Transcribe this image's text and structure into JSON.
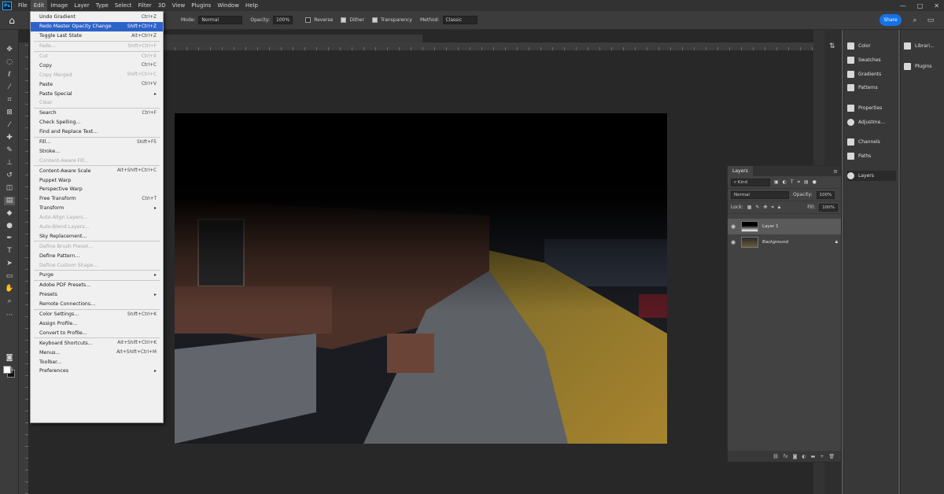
{
  "menubar": {
    "app_icon": "Ps",
    "items": [
      "File",
      "Edit",
      "Image",
      "Layer",
      "Type",
      "Select",
      "Filter",
      "3D",
      "View",
      "Plugins",
      "Window",
      "Help"
    ],
    "window_controls": [
      "—",
      "□",
      "✕"
    ]
  },
  "options_bar": {
    "mode_label": "Mode:",
    "mode_value": "Normal",
    "opacity_label": "Opacity:",
    "opacity_value": "100%",
    "reverse_label": "Reverse",
    "dither_label": "Dither",
    "transparency_label": "Transparency",
    "method_label": "Method:",
    "method_value": "Classic",
    "share_label": "Share"
  },
  "edit_menu": {
    "groups": [
      [
        {
          "label": "Undo Gradient",
          "shortcut": "Ctrl+Z"
        },
        {
          "label": "Redo Master Opacity Change",
          "shortcut": "Shift+Ctrl+Z",
          "highlight": true
        },
        {
          "label": "Toggle Last State",
          "shortcut": "Alt+Ctrl+Z"
        }
      ],
      [
        {
          "label": "Fade...",
          "shortcut": "Shift+Ctrl+F",
          "disabled": true
        }
      ],
      [
        {
          "label": "Cut",
          "shortcut": "Ctrl+X",
          "disabled": true
        },
        {
          "label": "Copy",
          "shortcut": "Ctrl+C"
        },
        {
          "label": "Copy Merged",
          "shortcut": "Shift+Ctrl+C",
          "disabled": true
        },
        {
          "label": "Paste",
          "shortcut": "Ctrl+V"
        },
        {
          "label": "Paste Special",
          "shortcut": "",
          "submenu": true
        },
        {
          "label": "Clear",
          "shortcut": "",
          "disabled": true
        }
      ],
      [
        {
          "label": "Search",
          "shortcut": "Ctrl+F"
        },
        {
          "label": "Check Spelling...",
          "shortcut": ""
        },
        {
          "label": "Find and Replace Text...",
          "shortcut": ""
        }
      ],
      [
        {
          "label": "Fill...",
          "shortcut": "Shift+F5"
        },
        {
          "label": "Stroke...",
          "shortcut": ""
        },
        {
          "label": "Content-Aware Fill...",
          "shortcut": "",
          "disabled": true
        }
      ],
      [
        {
          "label": "Content-Aware Scale",
          "shortcut": "Alt+Shift+Ctrl+C"
        },
        {
          "label": "Puppet Warp",
          "shortcut": ""
        },
        {
          "label": "Perspective Warp",
          "shortcut": ""
        },
        {
          "label": "Free Transform",
          "shortcut": "Ctrl+T"
        },
        {
          "label": "Transform",
          "shortcut": "",
          "submenu": true
        },
        {
          "label": "Auto-Align Layers...",
          "shortcut": "",
          "disabled": true
        },
        {
          "label": "Auto-Blend Layers...",
          "shortcut": "",
          "disabled": true
        },
        {
          "label": "Sky Replacement...",
          "shortcut": ""
        }
      ],
      [
        {
          "label": "Define Brush Preset...",
          "shortcut": "",
          "disabled": true
        },
        {
          "label": "Define Pattern...",
          "shortcut": ""
        },
        {
          "label": "Define Custom Shape...",
          "shortcut": "",
          "disabled": true
        }
      ],
      [
        {
          "label": "Purge",
          "shortcut": "",
          "submenu": true
        }
      ],
      [
        {
          "label": "Adobe PDF Presets...",
          "shortcut": ""
        },
        {
          "label": "Presets",
          "shortcut": "",
          "submenu": true
        },
        {
          "label": "Remote Connections...",
          "shortcut": ""
        }
      ],
      [
        {
          "label": "Color Settings...",
          "shortcut": "Shift+Ctrl+K"
        },
        {
          "label": "Assign Profile...",
          "shortcut": ""
        },
        {
          "label": "Convert to Profile...",
          "shortcut": ""
        }
      ],
      [
        {
          "label": "Keyboard Shortcuts...",
          "shortcut": "Alt+Shift+Ctrl+K"
        },
        {
          "label": "Menus...",
          "shortcut": "Alt+Shift+Ctrl+M"
        },
        {
          "label": "Toolbar...",
          "shortcut": ""
        },
        {
          "label": "Preferences",
          "shortcut": "",
          "submenu": true
        }
      ]
    ]
  },
  "right_panels": {
    "column1": [
      "Color",
      "Swatches",
      "Gradients",
      "Patterns",
      "Properties",
      "Adjustme...",
      "Channels",
      "Paths",
      "Layers"
    ],
    "column2": [
      "Librari...",
      "Plugins"
    ]
  },
  "layers_panel": {
    "tab_label": "Layers",
    "kind_label": "Kind",
    "blend_mode": "Normal",
    "opacity_label": "Opacity:",
    "opacity_value": "100%",
    "lock_label": "Lock:",
    "fill_label": "Fill:",
    "fill_value": "100%",
    "layers": [
      {
        "name": "Layer 1",
        "selected": true
      },
      {
        "name": "Background",
        "locked": true
      }
    ]
  },
  "colors": {
    "accent": "#1473e6",
    "menu_highlight": "#2d62c8"
  }
}
